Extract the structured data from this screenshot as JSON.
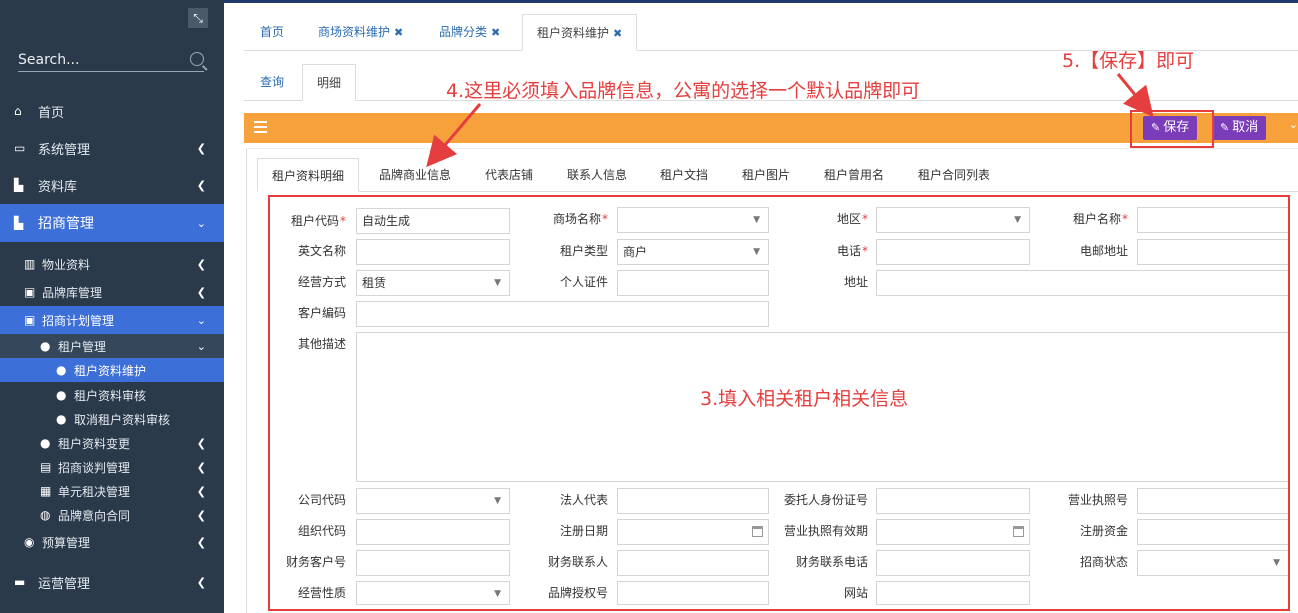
{
  "sidebar": {
    "search_placeholder": "Search...",
    "items": [
      {
        "label": "首页",
        "icon": "home-icon"
      },
      {
        "label": "系统管理",
        "icon": "desktop-icon"
      },
      {
        "label": "资料库",
        "icon": "bar-chart-icon"
      },
      {
        "label": "招商管理",
        "icon": "bar-chart-icon"
      },
      {
        "label": "物业资料",
        "icon": "building-icon"
      },
      {
        "label": "品牌库管理",
        "icon": "clipboard-icon"
      },
      {
        "label": "招商计划管理",
        "icon": "clipboard-icon"
      },
      {
        "label": "租户管理",
        "icon": "user-icon"
      },
      {
        "label": "租户资料维护",
        "icon": "user-edit-icon"
      },
      {
        "label": "租户资料审核",
        "icon": "user-check-icon"
      },
      {
        "label": "取消租户资料审核",
        "icon": "user-cancel-icon"
      },
      {
        "label": "租户资料变更",
        "icon": "users-icon"
      },
      {
        "label": "招商谈判管理",
        "icon": "chat-icon"
      },
      {
        "label": "单元租决管理",
        "icon": "table-icon"
      },
      {
        "label": "品牌意向合同",
        "icon": "bulb-icon"
      },
      {
        "label": "预算管理",
        "icon": "search-dollar-icon"
      },
      {
        "label": "运营管理",
        "icon": "comments-icon"
      }
    ]
  },
  "page_tabs": [
    {
      "label": "首页",
      "closable": false
    },
    {
      "label": "商场资料维护",
      "closable": true
    },
    {
      "label": "品牌分类",
      "closable": true
    },
    {
      "label": "租户资料维护",
      "closable": true
    }
  ],
  "sub_tabs": [
    "查询",
    "明细"
  ],
  "toolbar": {
    "save_label": "保存",
    "cancel_label": "取消"
  },
  "inner_tabs": [
    "租户资料明细",
    "品牌商业信息",
    "代表店铺",
    "联系人信息",
    "租户文挡",
    "租户图片",
    "租户曾用名",
    "租户合同列表"
  ],
  "form": {
    "tenant_code_label": "租户代码",
    "tenant_code_value": "自动生成",
    "mall_name_label": "商场名称",
    "region_label": "地区",
    "tenant_name_label": "租户名称",
    "english_name_label": "英文名称",
    "tenant_type_label": "租户类型",
    "tenant_type_value": "商户",
    "phone_label": "电话",
    "email_label": "电邮地址",
    "business_mode_label": "经营方式",
    "business_mode_value": "租赁",
    "personal_id_label": "个人证件",
    "address_label": "地址",
    "customer_code_label": "客户编码",
    "other_desc_label": "其他描述",
    "company_code_label": "公司代码",
    "legal_rep_label": "法人代表",
    "agent_id_label": "委托人身份证号",
    "license_no_label": "营业执照号",
    "org_code_label": "组织代码",
    "reg_date_label": "注册日期",
    "license_valid_label": "营业执照有效期",
    "reg_capital_label": "注册资金",
    "fin_customer_label": "财务客户号",
    "fin_contact_label": "财务联系人",
    "fin_phone_label": "财务联系电话",
    "invest_status_label": "招商状态",
    "business_nature_label": "经营性质",
    "brand_auth_label": "品牌授权号",
    "website_label": "网站"
  },
  "annotations": {
    "note3": "3.填入相关租户相关信息",
    "note4": "4.这里必须填入品牌信息，公寓的选择一个默认品牌即可",
    "note5": "5.【保存】即可"
  }
}
